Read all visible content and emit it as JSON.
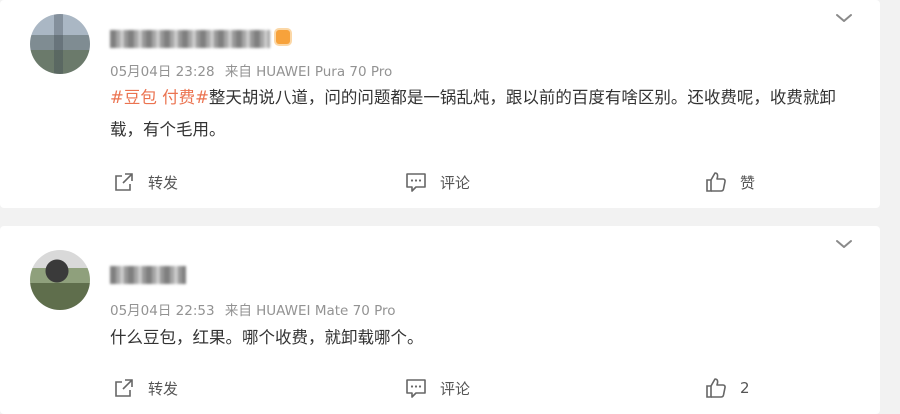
{
  "posts": [
    {
      "timestamp": "05月04日 23:28",
      "source": "来自 HUAWEI Pura 70 Pro",
      "tag": "#豆包 付费#",
      "text": "整天胡说八道，问的问题都是一锅乱炖，跟以前的百度有啥区别。还收费呢，收费就卸载，有个毛用。",
      "repost_label": "转发",
      "comment_label": "评论",
      "like_label": "赞"
    },
    {
      "timestamp": "05月04日 22:53",
      "source": "来自 HUAWEI Mate 70 Pro",
      "text": "什么豆包，红果。哪个收费，就卸载哪个。",
      "repost_label": "转发",
      "comment_label": "评论",
      "like_label": "2"
    }
  ],
  "icons": {
    "menu": "chevron-down-icon",
    "repost": "share-icon",
    "comment": "comment-icon",
    "like": "thumbs-up-icon"
  },
  "colors": {
    "tag": "#eb7350",
    "meta": "#939393",
    "background": "#f2f2f2"
  }
}
